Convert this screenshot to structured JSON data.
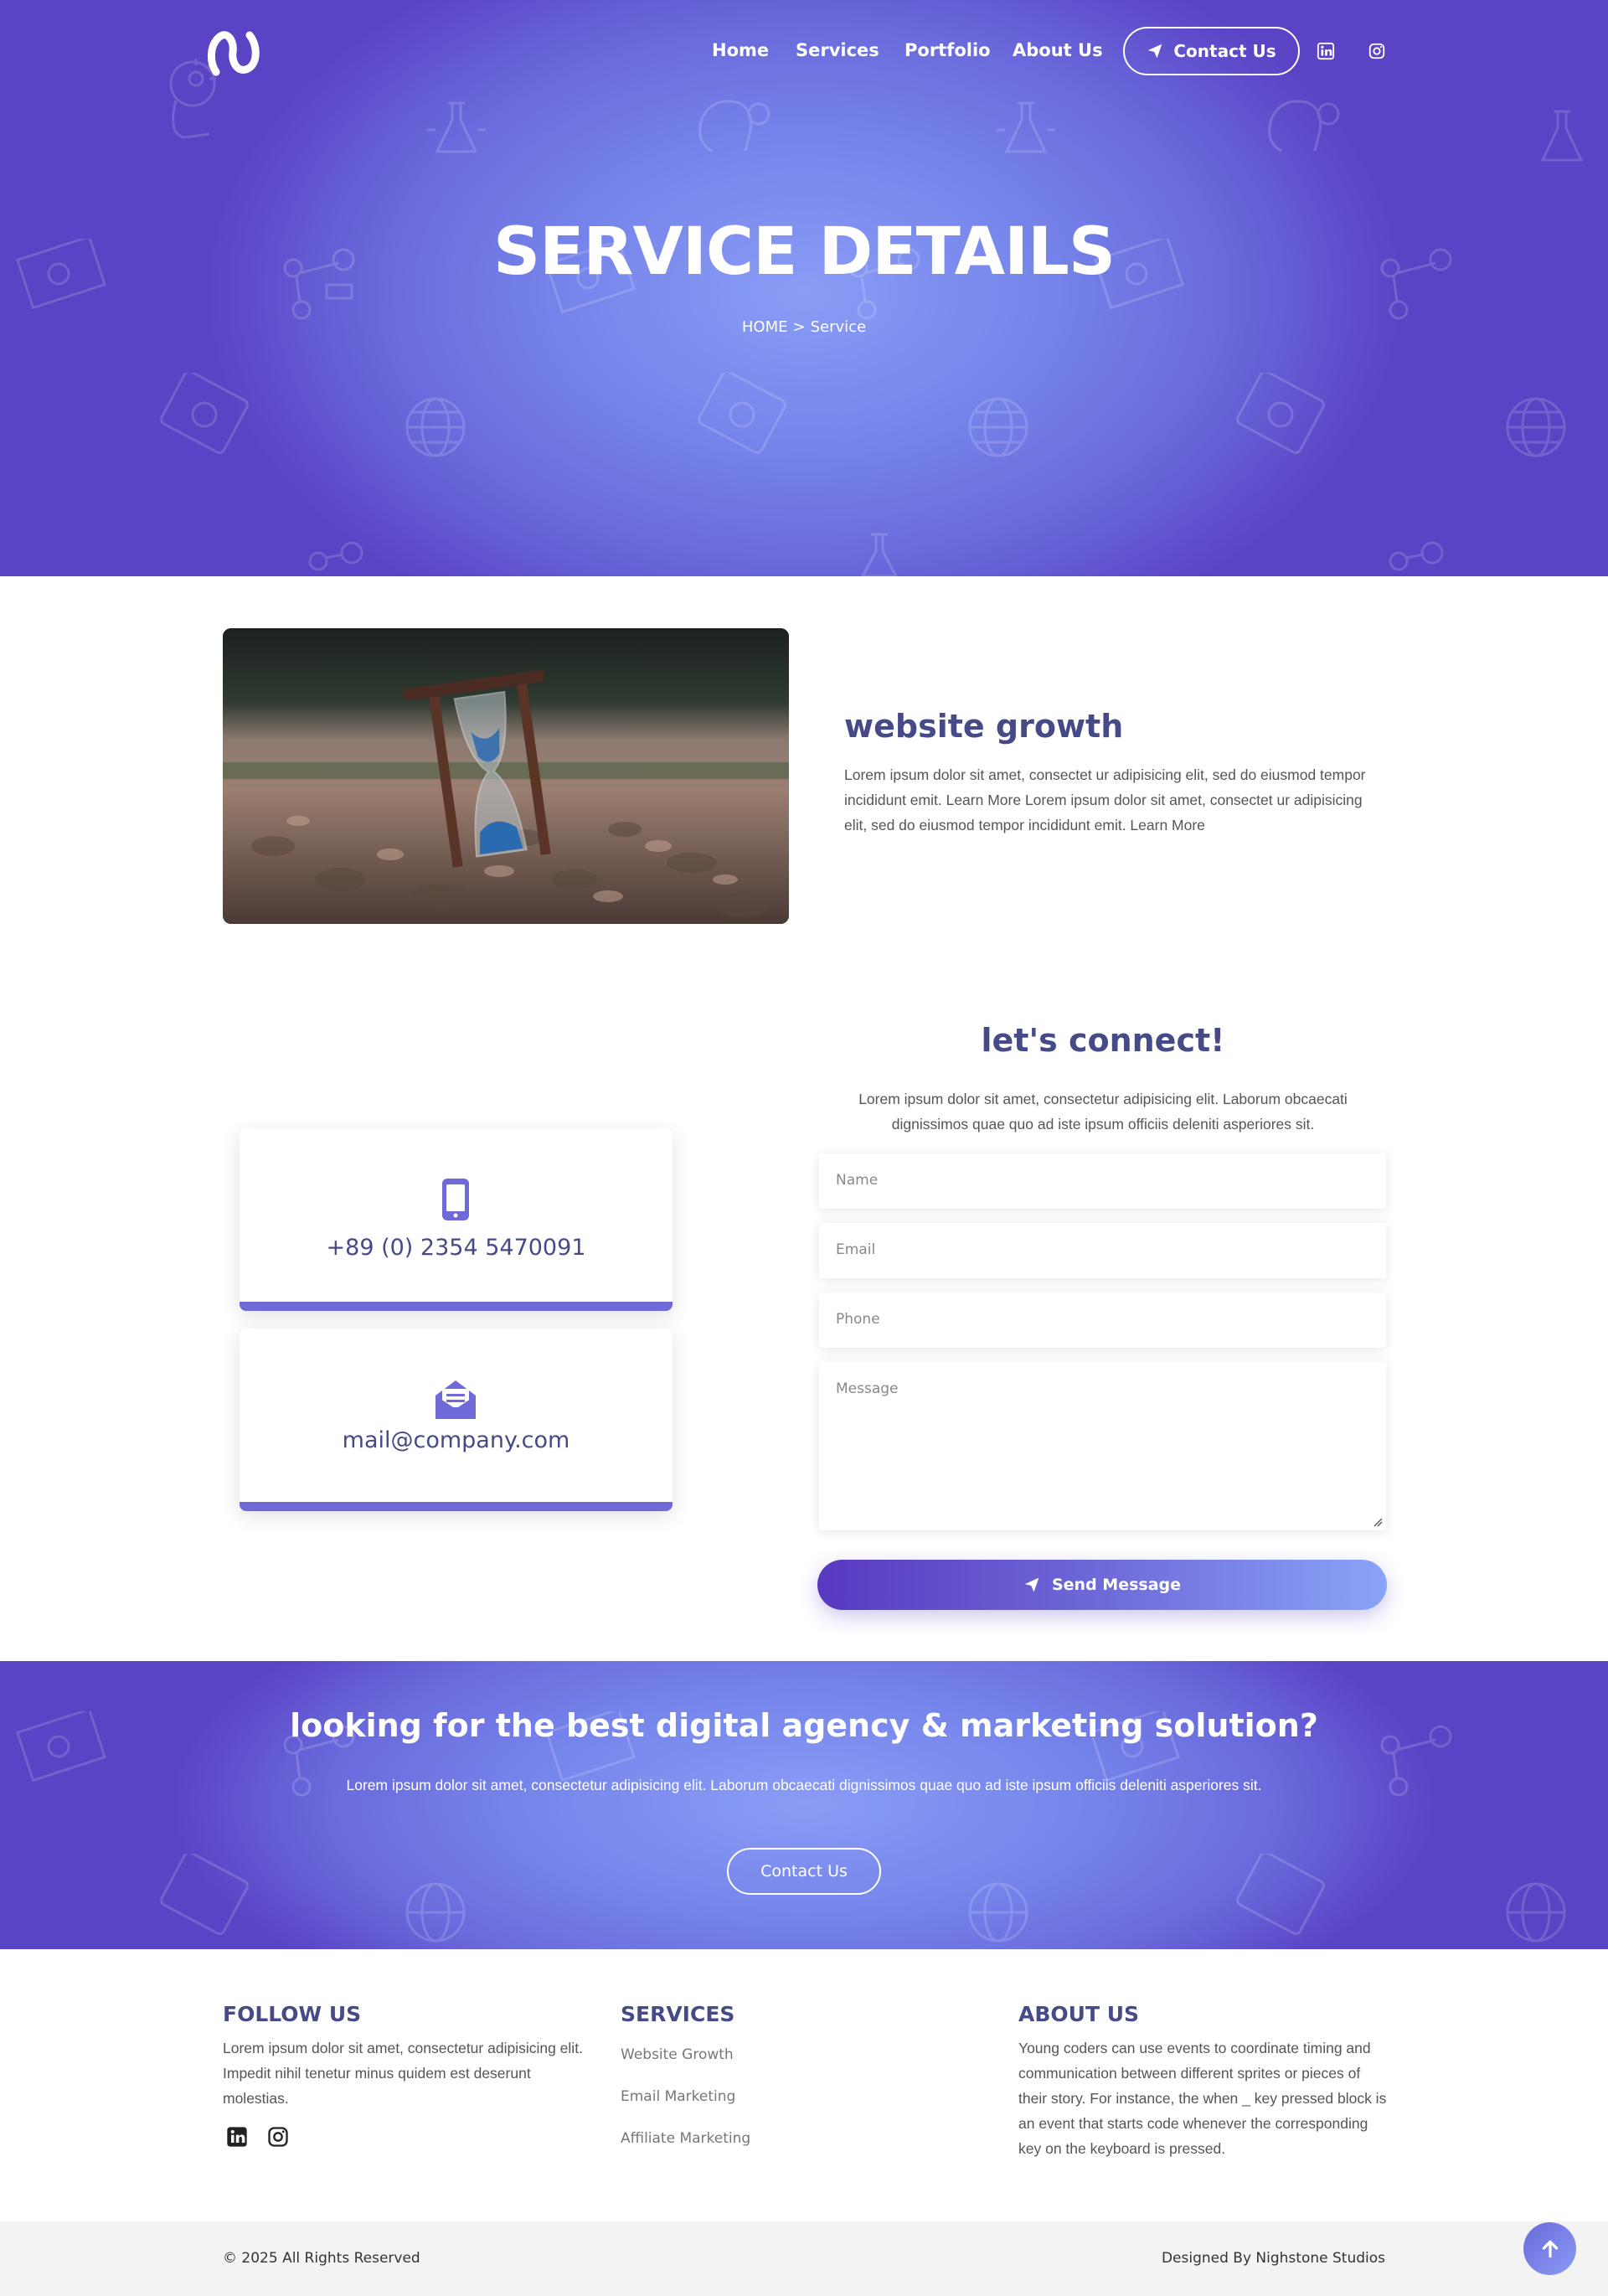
{
  "nav": {
    "links": [
      "Home",
      "Services",
      "Portfolio",
      "About Us"
    ],
    "contact_label": "Contact Us"
  },
  "hero": {
    "title": "SERVICE DETAILS",
    "breadcrumb": {
      "home": "HOME",
      "separator": ">",
      "current": "Service"
    }
  },
  "service": {
    "title": "website growth",
    "text": "Lorem ipsum dolor sit amet, consectet ur adipisicing elit, sed do eiusmod tempor incididunt emit. Learn More Lorem ipsum dolor sit amet, consectet ur adipisicing elit, sed do eiusmod tempor incididunt emit. Learn More"
  },
  "contact": {
    "phone": "+89 (0) 2354 5470091",
    "email": "mail@company.com",
    "title": "let's connect!",
    "text": "Lorem ipsum dolor sit amet, consectetur adipisicing elit. Laborum obcaecati dignissimos quae quo ad iste ipsum officiis deleniti asperiores sit.",
    "placeholders": {
      "name": "Name",
      "email": "Email",
      "phone": "Phone",
      "message": "Message"
    },
    "send_label": "Send Message"
  },
  "cta": {
    "title": "looking for the best digital agency & marketing solution?",
    "text": "Lorem ipsum dolor sit amet, consectetur adipisicing elit. Laborum obcaecati dignissimos quae quo ad iste ipsum officiis deleniti asperiores sit.",
    "button": "Contact Us"
  },
  "footer": {
    "follow": {
      "heading": "FOLLOW US",
      "text": "Lorem ipsum dolor sit amet, consectetur adipisicing elit. Impedit nihil tenetur minus quidem est deserunt molestias."
    },
    "services": {
      "heading": "SERVICES",
      "links": [
        "Website Growth",
        "Email Marketing",
        "Affiliate Marketing"
      ]
    },
    "about": {
      "heading": "ABOUT US",
      "text": "Young coders can use events to coordinate timing and communication between different sprites or pieces of their story. For instance, the when _ key pressed block is an event that starts code whenever the corresponding key on the keyboard is pressed."
    },
    "copyright": "© 2025 All Rights Reserved",
    "designed_by": "Designed By Nighstone Studios"
  },
  "colors": {
    "brand_purple": "#5a43c4",
    "brand_light": "#8a9cf6",
    "heading": "#464a87",
    "accent_bar": "#6f6ad8"
  },
  "icons": [
    "logo-icon",
    "send-icon",
    "linkedin-icon",
    "instagram-icon",
    "phone-icon",
    "mail-icon",
    "arrow-up-icon"
  ]
}
